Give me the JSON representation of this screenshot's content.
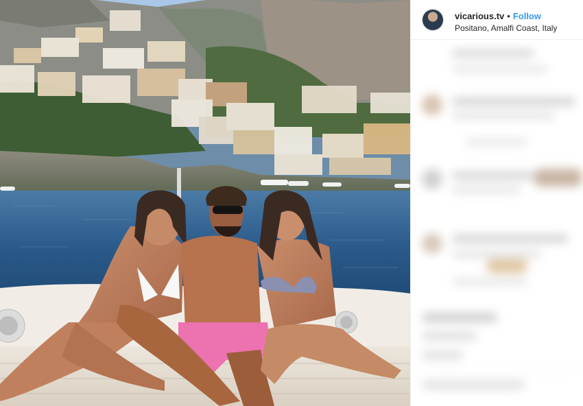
{
  "post": {
    "username": "vicarious.tv",
    "separator": "•",
    "follow_label": "Follow",
    "location": "Positano, Amalfi Coast, Italy"
  },
  "icons": {
    "avatar": "profile-avatar"
  },
  "colors": {
    "follow_blue": "#3897f0",
    "sea": "#2e5f8c",
    "sky": "#9fc3e8",
    "swimsuit_pink": "#e96aa7"
  }
}
